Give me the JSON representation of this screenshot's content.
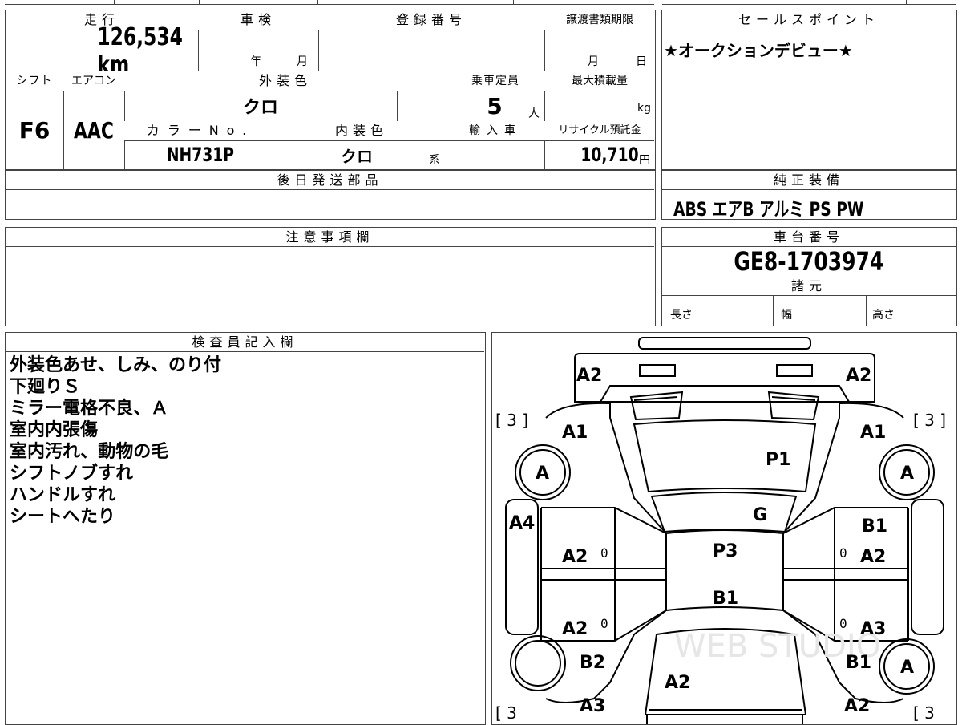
{
  "header": {
    "mileage_label": "走行",
    "inspection_label": "車検",
    "reg_number_label": "登録番号",
    "transfer_deadline_label": "譲渡書類期限",
    "sales_point_label": "セールスポイント"
  },
  "mileage": {
    "value": "126,534",
    "unit": "km"
  },
  "inspection": {
    "year": "年",
    "month": "月"
  },
  "transfer_deadline": {
    "month": "月",
    "day": "日"
  },
  "sales_point": {
    "text": "★オークションデビュー★"
  },
  "specs": {
    "shift_label": "シフト",
    "aircon_label": "エアコン",
    "exterior_color_label": "外装色",
    "capacity_label": "乗車定員",
    "max_load_label": "最大積載量",
    "shift": "F6",
    "aircon": "AAC",
    "exterior_color": "クロ",
    "capacity": "5",
    "capacity_unit": "人",
    "max_load_unit": "kg",
    "color_no_label": "カラーNo.",
    "interior_color_label": "内装色",
    "import_label": "輸入車",
    "recycle_label": "リサイクル預託金",
    "color_no": "NH731P",
    "interior_color": "クロ",
    "interior_suffix": "系",
    "recycle_fee": "10,710",
    "recycle_unit": "円"
  },
  "later_parts": {
    "label": "後日発送部品",
    "value": ""
  },
  "equipment": {
    "label": "純正装備",
    "items": "ABS エアB アルミ PS PW"
  },
  "notes": {
    "label": "注意事項欄",
    "value": ""
  },
  "chassis": {
    "label": "車台番号",
    "value": "GE8-1703974"
  },
  "dimensions": {
    "label": "諸元",
    "length": "長さ",
    "width": "幅",
    "height": "高さ"
  },
  "inspector": {
    "label": "検査員記入欄",
    "lines": [
      "外装色あせ、しみ、のり付",
      "下廻りＳ",
      "ミラー電格不良、Ａ",
      "室内内張傷",
      "室内汚れ、動物の毛",
      "シフトノブすれ",
      "ハンドルすれ",
      "シートへたり"
    ]
  },
  "diagram": {
    "tl_a2": "A2",
    "tr_a2": "A2",
    "l_a1": "A1",
    "r_a1": "A1",
    "p1": "P1",
    "g": "G",
    "p3": "P3",
    "b1_center": "B1",
    "a4": "A4",
    "r_b1": "B1",
    "l_mid_a2": "A2",
    "r_mid_a2": "A2",
    "l_low_a2": "A2",
    "r_low_a3": "A3",
    "l_b2": "B2",
    "r_b1_low": "B1",
    "rear_a2": "A2",
    "l_a3": "A3",
    "r_a2_bottom": "A2",
    "tire_fl": "A",
    "tire_fr": "A",
    "tire_rr": "A",
    "tread_tl": "[ 3 ]",
    "tread_tr": "[ 3 ]",
    "tread_bl": "[ 3",
    "tread_br": "[ 3",
    "zero": "0",
    "watermark": "WEB STUDIO"
  }
}
